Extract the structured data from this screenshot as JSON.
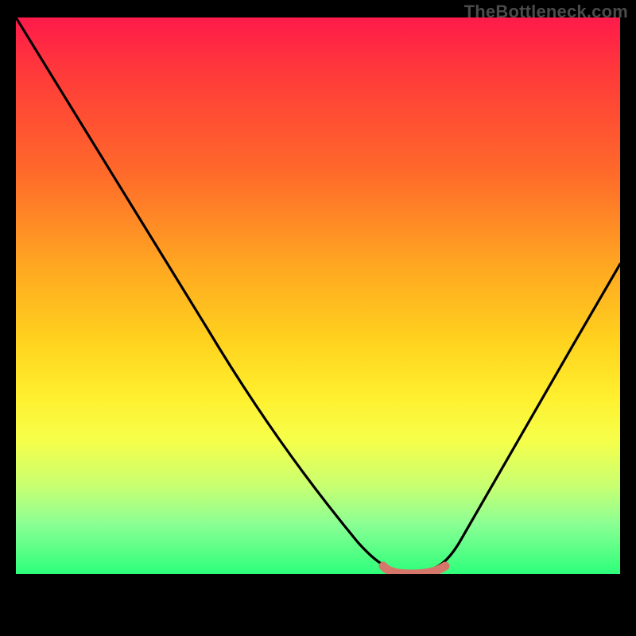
{
  "watermark": "TheBottleneck.com",
  "chart_data": {
    "type": "line",
    "title": "",
    "xlabel": "",
    "ylabel": "",
    "xlim": [
      0,
      100
    ],
    "ylim": [
      0,
      100
    ],
    "grid": false,
    "legend": false,
    "colors": {
      "gradient_top": "#ff1a4b",
      "gradient_bottom": "#2dff7a",
      "curve": "#000000",
      "marker": "#d4776a"
    },
    "series": [
      {
        "name": "bottleneck-curve",
        "x": [
          0,
          10,
          20,
          30,
          40,
          50,
          58,
          62,
          66,
          70,
          74,
          80,
          88,
          96,
          100
        ],
        "values": [
          100,
          85,
          70,
          55,
          40,
          25,
          12,
          5,
          1,
          1,
          2,
          8,
          20,
          35,
          42
        ]
      }
    ],
    "markers": [
      {
        "name": "sweet-spot",
        "x_start": 61,
        "x_end": 72,
        "y": 0.5
      }
    ]
  }
}
